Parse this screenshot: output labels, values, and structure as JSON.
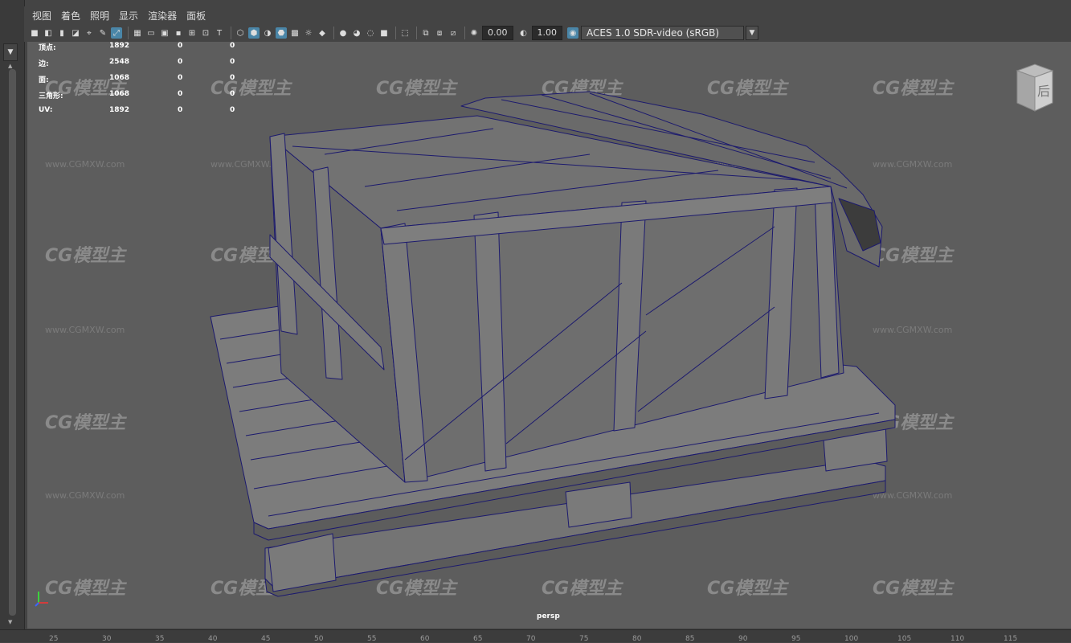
{
  "menu": [
    "视图",
    "着色",
    "照明",
    "显示",
    "渲染器",
    "面板"
  ],
  "toolbar": {
    "exposure_value": "0.00",
    "gamma_value": "1.00",
    "color_space": "ACES 1.0 SDR-video (sRGB)"
  },
  "hud": {
    "rows": [
      {
        "label": "顶点:",
        "v1": "1892",
        "v2": "0",
        "v3": "0"
      },
      {
        "label": "边:",
        "v1": "2548",
        "v2": "0",
        "v3": "0"
      },
      {
        "label": "面:",
        "v1": "1068",
        "v2": "0",
        "v3": "0"
      },
      {
        "label": "三角形:",
        "v1": "1068",
        "v2": "0",
        "v3": "0"
      },
      {
        "label": "UV:",
        "v1": "1892",
        "v2": "0",
        "v3": "0"
      }
    ]
  },
  "camera_label": "persp",
  "viewcube_label": "后",
  "watermark": {
    "logo": "CG模型主",
    "url": "www.CGMXW.com"
  },
  "ruler_ticks": [
    "25",
    "30",
    "35",
    "40",
    "45",
    "50",
    "55",
    "60",
    "65",
    "70",
    "75",
    "80",
    "85",
    "90",
    "95",
    "100",
    "105",
    "110",
    "115"
  ]
}
